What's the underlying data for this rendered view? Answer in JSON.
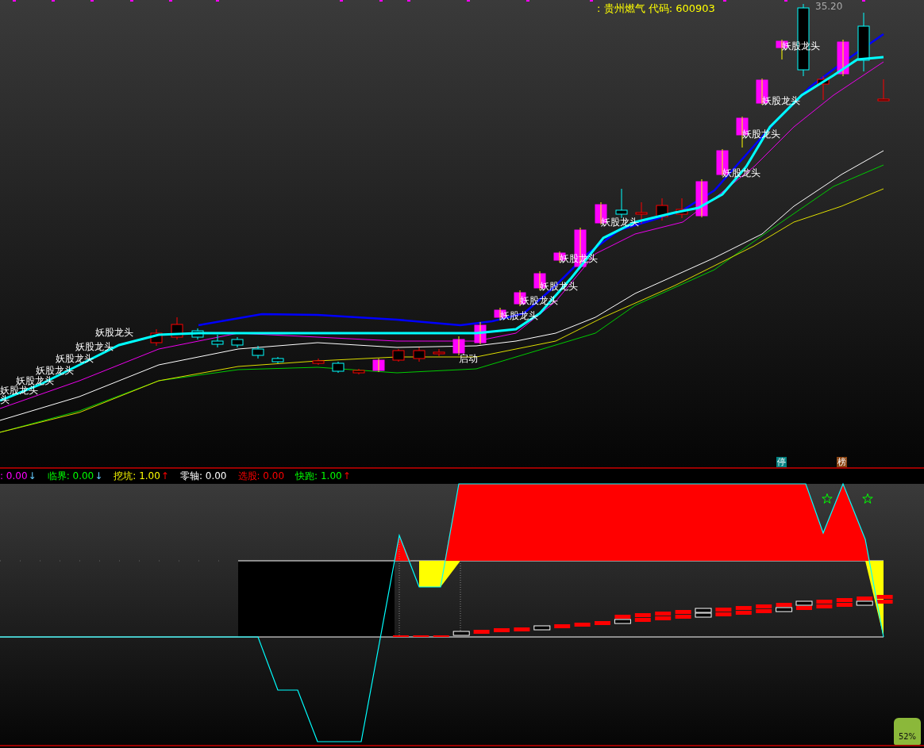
{
  "price_panel": {
    "title": ": 贵州燃气 代码: 600903",
    "high_price": "35.20",
    "signals": [
      {
        "text": "妖股龙头"
      },
      {
        "text": "妖股龙头"
      },
      {
        "text": "妖股龙头"
      },
      {
        "text": "妖股龙头"
      },
      {
        "text": "妖股龙头"
      },
      {
        "text": "妖股龙头"
      },
      {
        "text": "头"
      },
      {
        "text": "启动"
      },
      {
        "text": "妖股龙头"
      },
      {
        "text": "妖股龙头"
      },
      {
        "text": "妖股龙头"
      },
      {
        "text": "妖股龙头"
      },
      {
        "text": "妖股龙头"
      },
      {
        "text": "妖股龙头"
      },
      {
        "text": "妖股龙头"
      },
      {
        "text": "妖股龙头"
      },
      {
        "text": "妖股龙头"
      }
    ],
    "badges": [
      {
        "text": "停",
        "color": "#008080"
      },
      {
        "text": "榜",
        "color": "#8b4513"
      }
    ]
  },
  "indicator_legend": [
    {
      "text": ": 0.00",
      "arrow": "↓",
      "color": "#ff00ff"
    },
    {
      "text": "临界: 0.00",
      "arrow": "↓",
      "color": "#00ff00"
    },
    {
      "text": "挖坑: 1.00",
      "arrow": "↑",
      "color": "#ffff00"
    },
    {
      "text": "零轴: 0.00",
      "color": "#ffffff"
    },
    {
      "text": "选股: 0.00",
      "color": "#ff0000"
    },
    {
      "text": "快跑: 1.00",
      "arrow": "↑",
      "color": "#00ff00"
    }
  ],
  "widget": {
    "text": "52%"
  }
}
